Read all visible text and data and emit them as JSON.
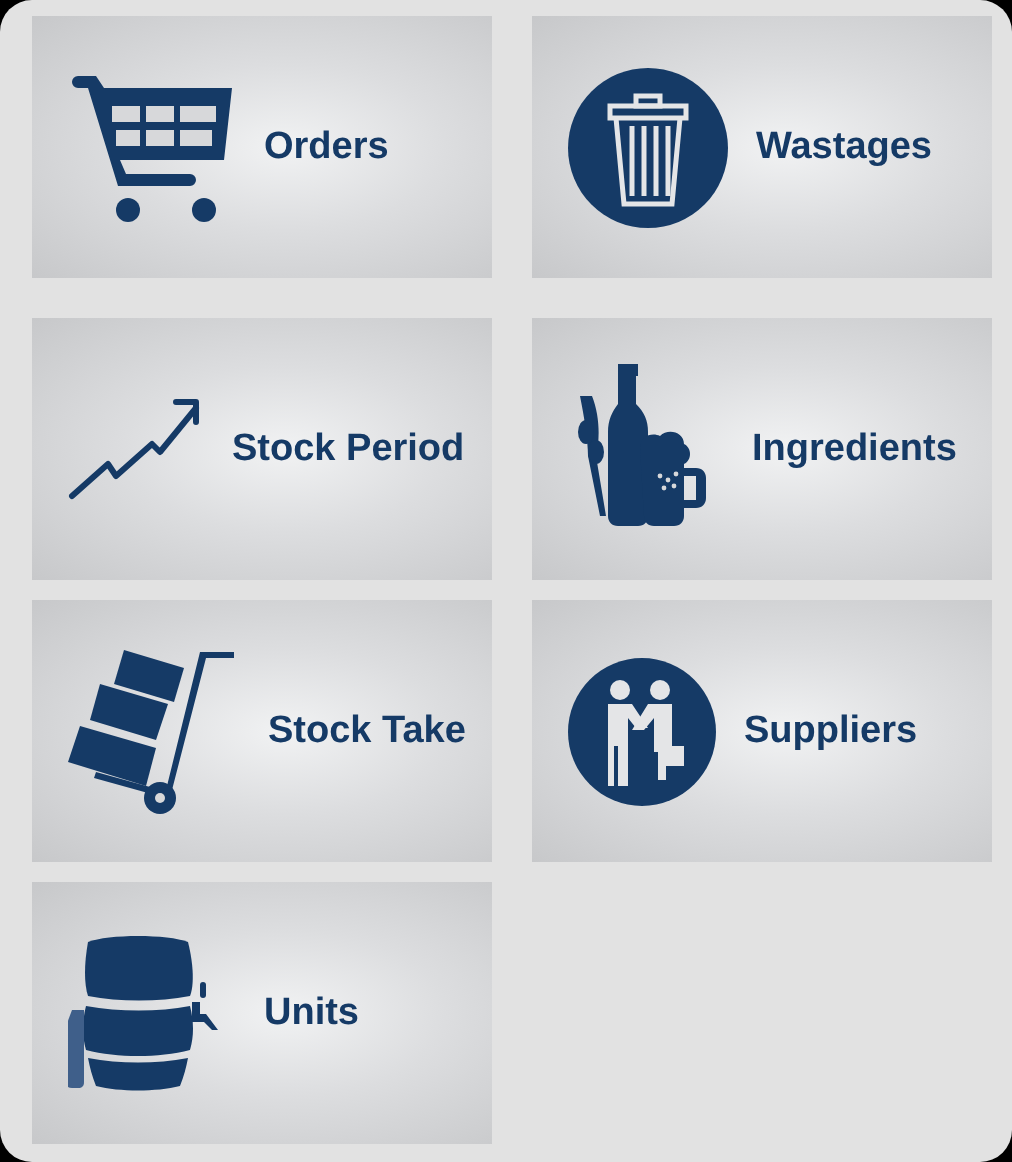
{
  "tiles": [
    {
      "label": "Orders",
      "kind": "cart"
    },
    {
      "label": "Wastages",
      "kind": "trash"
    },
    {
      "label": "Stock Period",
      "kind": "trend"
    },
    {
      "label": "Ingredients",
      "kind": "drinks"
    },
    {
      "label": "Stock Take",
      "kind": "trolley"
    },
    {
      "label": "Suppliers",
      "kind": "handshake"
    },
    {
      "label": "Units",
      "kind": "keg"
    }
  ]
}
